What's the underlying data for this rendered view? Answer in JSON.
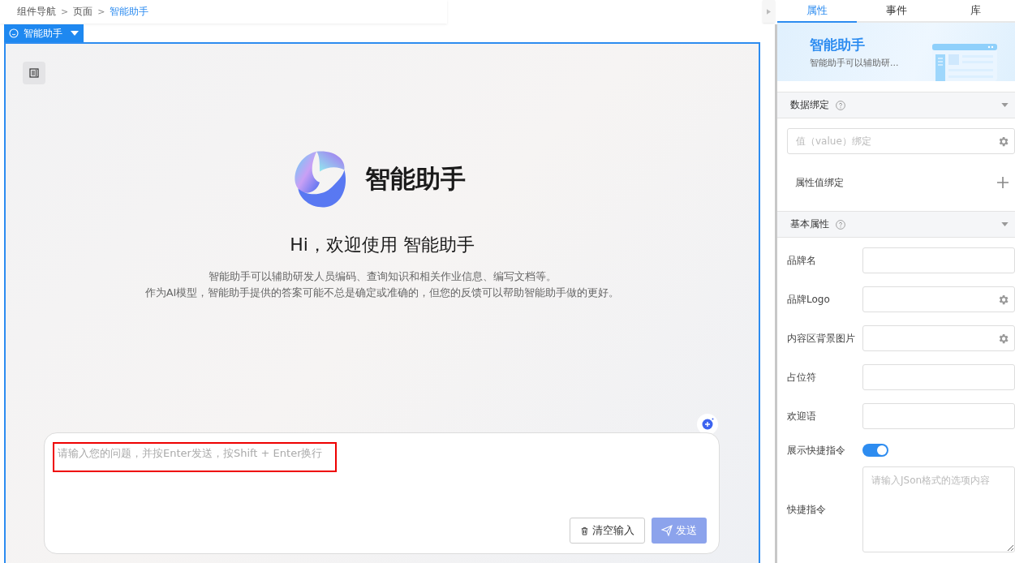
{
  "breadcrumb": [
    {
      "label": "组件导航",
      "selected": false
    },
    {
      "label": "页面",
      "selected": false
    },
    {
      "label": "智能助手",
      "selected": true
    }
  ],
  "separator": ">",
  "component_tag": {
    "label": "智能助手"
  },
  "assistant": {
    "brand": "智能助手",
    "greeting": "Hi，欢迎使用 智能助手",
    "description": [
      "智能助手可以辅助研发人员编码、查询知识和相关作业信息、编写文档等。",
      "作为AI模型，智能助手提供的答案可能不总是确定或准确的，但您的反馈可以帮助智能助手做的更好。"
    ],
    "input": {
      "placeholder": "请输入您的问题，并按Enter发送，按Shift + Enter换行",
      "highlighted": true
    },
    "buttons": [
      {
        "label": "清空输入",
        "kind": "clear",
        "disabled": false
      },
      {
        "label": "发送",
        "kind": "send",
        "disabled": true
      }
    ]
  },
  "panel": {
    "tabs": [
      {
        "label": "属性",
        "selected": true
      },
      {
        "label": "事件",
        "selected": false
      },
      {
        "label": "库",
        "selected": false
      }
    ],
    "banner": {
      "title": "智能助手",
      "subtitle": "智能助手可以辅助研..."
    },
    "sections": [
      {
        "title": "数据绑定",
        "expanded": true,
        "rows": [
          {
            "kind": "binding",
            "placeholder": "值（value）绑定"
          },
          {
            "kind": "add",
            "label": "属性值绑定"
          }
        ]
      },
      {
        "title": "基本属性",
        "expanded": true,
        "rows": [
          {
            "kind": "text",
            "label": "品牌名"
          },
          {
            "kind": "picker",
            "label": "品牌Logo"
          },
          {
            "kind": "picker",
            "label": "内容区背景图片"
          },
          {
            "kind": "text",
            "label": "占位符"
          },
          {
            "kind": "text",
            "label": "欢迎语"
          },
          {
            "kind": "switch",
            "label": "展示快捷指令",
            "on": true
          },
          {
            "kind": "textarea",
            "label": "快捷指令",
            "placeholder": "请输入JSon格式的选项内容"
          }
        ]
      }
    ]
  }
}
